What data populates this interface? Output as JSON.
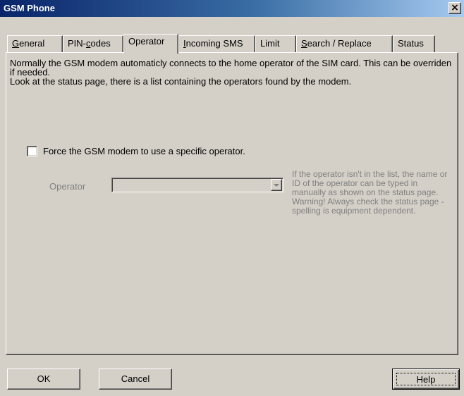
{
  "window": {
    "title": "GSM Phone",
    "close_glyph": "×"
  },
  "tabs": [
    {
      "pre": "",
      "key": "G",
      "post": "eneral"
    },
    {
      "pre": "PIN-",
      "key": "c",
      "post": "odes"
    },
    {
      "pre": "",
      "key": "",
      "post": "Operator"
    },
    {
      "pre": "",
      "key": "I",
      "post": "ncoming SMS"
    },
    {
      "pre": "",
      "key": "",
      "post": "Limit"
    },
    {
      "pre": "",
      "key": "S",
      "post": "earch / Replace"
    },
    {
      "pre": "",
      "key": "",
      "post": "Status"
    }
  ],
  "active_tab": "Operator",
  "operator_page": {
    "desc_line1": "Normally the GSM modem automaticly connects to the home operator of the SIM card. This can be overriden if needed.",
    "desc_line2": "Look at the status page, there is a list containing the operators found by the modem.",
    "force_label": "Force the GSM modem to use a specific operator.",
    "force_checked": false,
    "operator_label": "Operator",
    "operator_value": "",
    "hint": "If the operator isn't in the list, the name or ID of the operator can be typed in manually as shown on the status page. Warning! Always check the status page - spelling is equipment dependent."
  },
  "buttons": {
    "ok": "OK",
    "cancel": "Cancel",
    "help": "Help"
  }
}
